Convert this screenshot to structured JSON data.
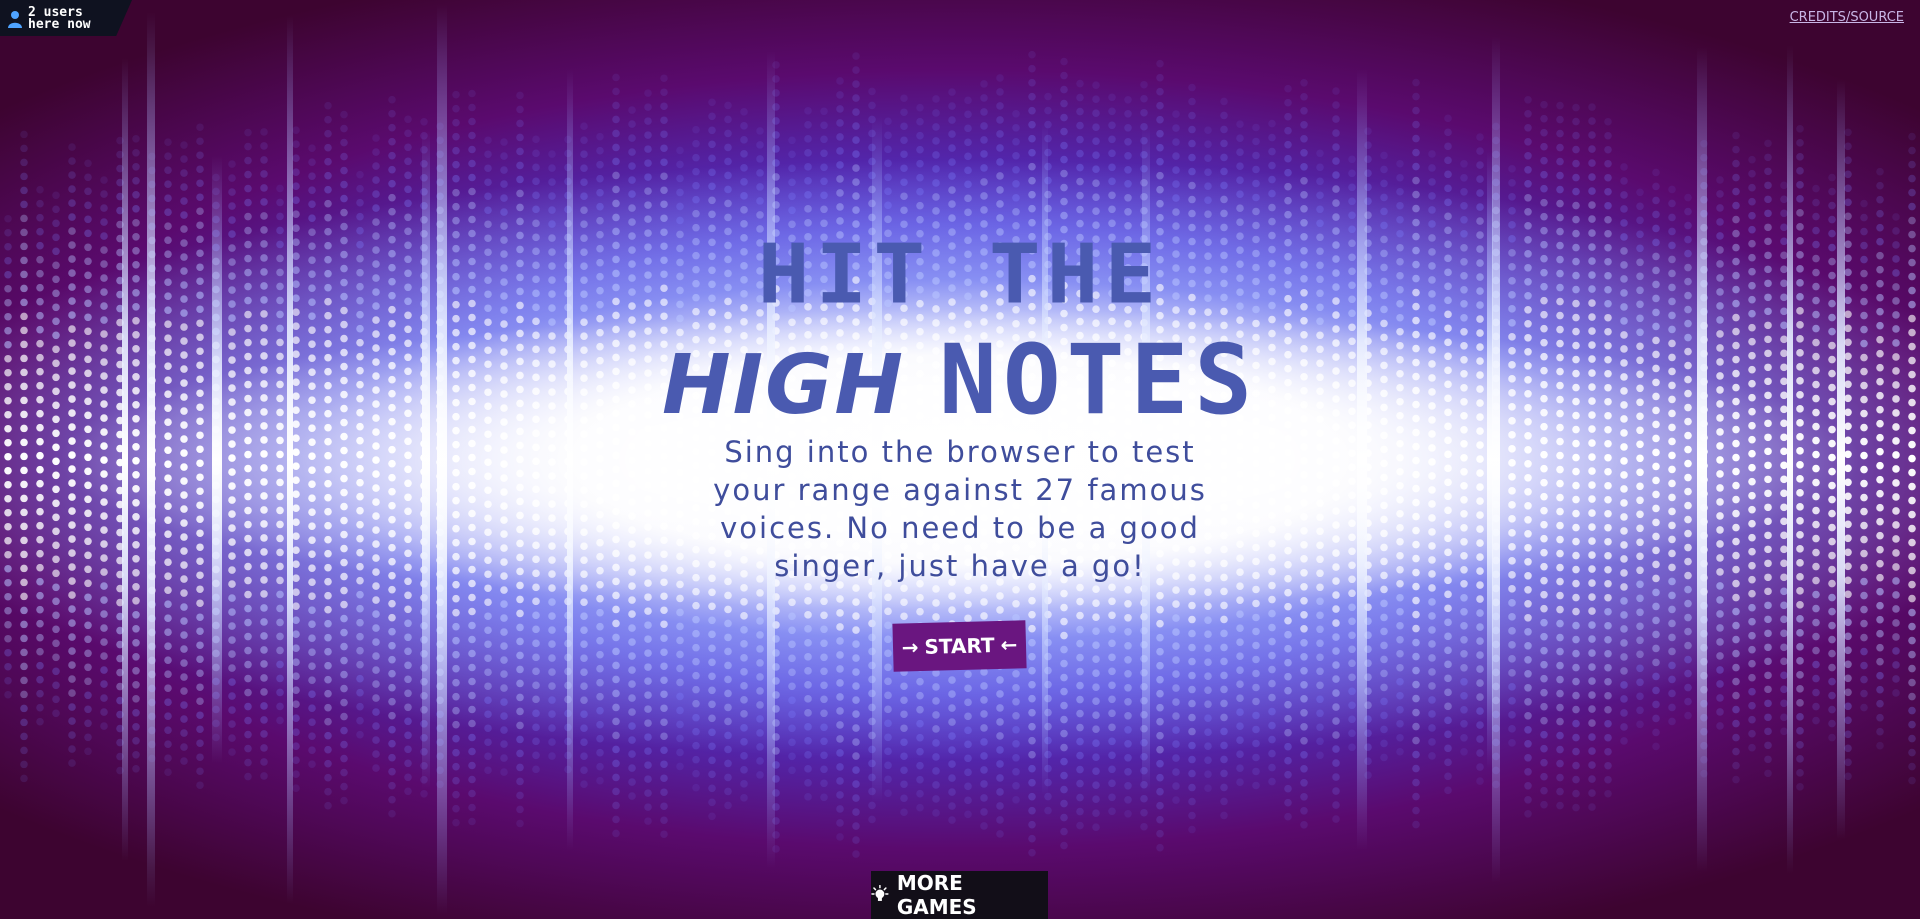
{
  "users": {
    "text": "2 users\nhere now",
    "icon": "user-icon"
  },
  "credits": {
    "label": "CREDITS/SOURCE"
  },
  "title": {
    "line1": "HIT THE",
    "high": "HIGH",
    "notes": "NOTES"
  },
  "subtitle": "Sing into the browser to test your range against 27 famous voices. No need to be a good singer, just have a go!",
  "start": {
    "arrow_left": "→",
    "label": "START",
    "arrow_right": "←"
  },
  "more_games": {
    "label": "MORE GAMES",
    "icon": "lightbulb-icon"
  },
  "colors": {
    "title": "#4a5ab0",
    "start_bg": "#6a1680",
    "more_games_bg": "#120e18",
    "background_edge": "#3d0430",
    "background_mid": "#4d3ad8"
  }
}
